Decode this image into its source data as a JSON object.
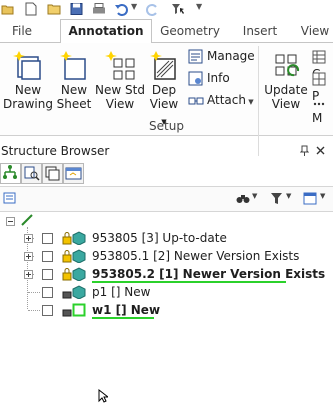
{
  "ribbon_tabs": {
    "file": "File",
    "annotation": "Annotation",
    "geometry": "Geometry",
    "insert": "Insert",
    "view": "View"
  },
  "ribbon": {
    "new_drawing": "New\nDrawing",
    "new_drawing_l1": "New",
    "new_drawing_l2": "Drawing",
    "new_sheet_l1": "New",
    "new_sheet_l2": "Sheet",
    "new_std_view_l1": "New Std",
    "new_std_view_l2": "View",
    "dep_view_l1": "Dep",
    "dep_view_l2": "View",
    "manage": "Manage",
    "info": "Info",
    "attach": "Attach",
    "update_view_l1": "Update",
    "update_view_l2": "View",
    "group_label": "Setup",
    "right_cut_1": "C",
    "right_cut_2": "P",
    "right_cut_3": "M"
  },
  "pane": {
    "title": "Structure Browser",
    "pin_icon": "pin-icon",
    "close_icon": "close-icon"
  },
  "tree": {
    "rows": [
      {
        "label": "953805 [3] Up-to-date",
        "bold": false,
        "status": "up-to-date"
      },
      {
        "label": "953805.1 [2] Newer Version Exists",
        "bold": false,
        "status": "newer"
      },
      {
        "label": "953805.2 [1] Newer Version Exists",
        "bold": true,
        "status": "newer"
      },
      {
        "label": "p1 [] New",
        "bold": false,
        "status": "new"
      },
      {
        "label": "w1 [] New",
        "bold": true,
        "status": "new"
      }
    ]
  },
  "colors": {
    "accent_green": "#2bd12b",
    "lock_yellow": "#f3c300",
    "part_teal": "#3aa8a0"
  }
}
